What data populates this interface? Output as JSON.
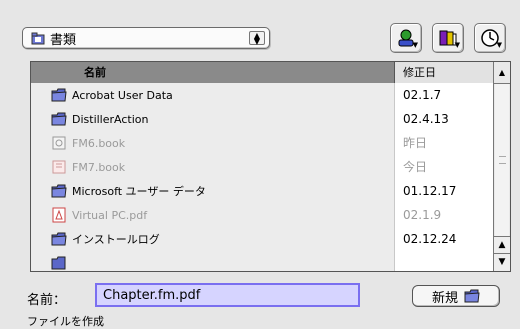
{
  "location_popup": {
    "label": "書類",
    "icon": "folder-icon"
  },
  "toolbar": {
    "buttons": [
      {
        "icon": "user-icon"
      },
      {
        "icon": "books-icon"
      },
      {
        "icon": "clock-icon"
      }
    ]
  },
  "file_list": {
    "columns": {
      "name": "名前",
      "date": "修正日"
    },
    "rows": [
      {
        "name": "Acrobat User Data",
        "date": "02.1.7",
        "icon": "folder-icon",
        "dim": false
      },
      {
        "name": "DistillerAction",
        "date": "02.4.13",
        "icon": "folder-icon",
        "dim": false
      },
      {
        "name": "FM6.book",
        "date": "昨日",
        "icon": "book-file-icon",
        "dim": true
      },
      {
        "name": "FM7.book",
        "date": "今日",
        "icon": "book-file-icon",
        "dim": true
      },
      {
        "name": "Microsoft ユーザー データ",
        "date": "01.12.17",
        "icon": "folder-icon",
        "dim": false
      },
      {
        "name": "Virtual PC.pdf",
        "date": "02.1.9",
        "icon": "pdf-file-icon",
        "dim": true
      },
      {
        "name": "インストールログ",
        "date": "02.12.24",
        "icon": "folder-icon",
        "dim": false
      }
    ]
  },
  "save_form": {
    "name_label": "名前：",
    "file_name": "Chapter.fm.pdf",
    "new_button_label": "新規",
    "status_text": "ファイルを作成"
  },
  "colors": {
    "selection": "#d6d4ff",
    "selection_border": "#7a6ff0",
    "folder": "#5b67c8"
  }
}
